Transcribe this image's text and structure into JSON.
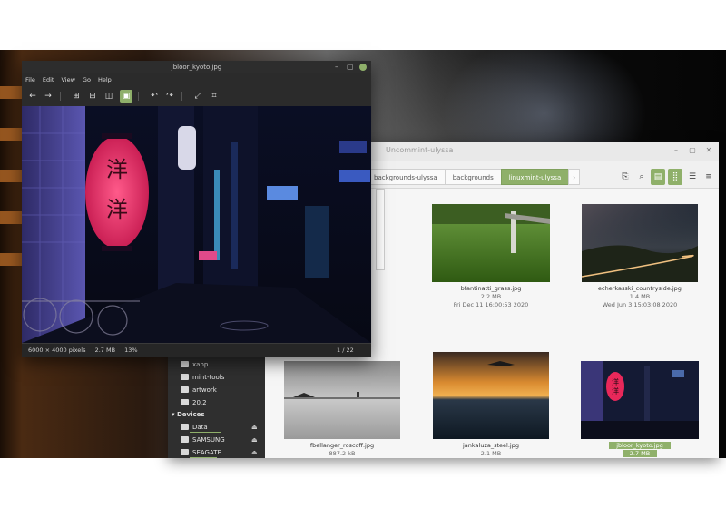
{
  "viewer": {
    "title": "jbloor_kyoto.jpg",
    "menu": [
      "File",
      "Edit",
      "View",
      "Go",
      "Help"
    ],
    "status": {
      "dimensions": "6000 × 4000 pixels",
      "size": "2.7 MB",
      "zoom": "13%",
      "position": "1 / 22"
    },
    "lantern_chars": [
      "洋",
      "洋"
    ]
  },
  "nemo": {
    "title": "Uncommint-ulyssa",
    "breadcrumb": [
      "backgrounds-ulyssa",
      "backgrounds",
      "linuxmint-ulyssa",
      "›"
    ],
    "sidebar": {
      "places": [
        "xapp",
        "mint-tools",
        "artwork",
        "20.2"
      ],
      "devices_header": "Devices",
      "devices": [
        "Data",
        "SAMSUNG",
        "SEAGATE"
      ]
    },
    "files": [
      {
        "name": "bfantinatti_grass.jpg",
        "size": "2.2 MB",
        "date": "Fri Dec 11 16:00:53 2020"
      },
      {
        "name": "echerkasski_countryside.jpg",
        "size": "1.4 MB",
        "date": "Wed Jun 3 15:03:08 2020"
      },
      {
        "name": "fbellanger_roscoff.jpg",
        "size": "887.2 kB"
      },
      {
        "name": "jankaluza_steel.jpg",
        "size": "2.1 MB"
      },
      {
        "name": "jbloor_kyoto.jpg",
        "size": "2.7 MB",
        "selected": true
      }
    ]
  },
  "colors": {
    "accent": "#8fb06a",
    "dark_panel": "#2b2b2b"
  }
}
